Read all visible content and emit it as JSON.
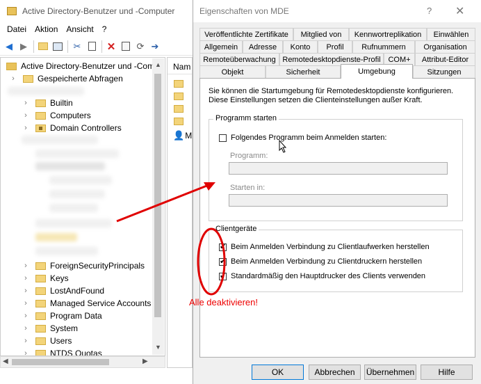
{
  "main_window": {
    "title": "Active Directory-Benutzer und -Computer",
    "menu": [
      "Datei",
      "Aktion",
      "Ansicht",
      "?"
    ],
    "tree_root": "Active Directory-Benutzer und -Com",
    "tree_items_top": [
      "Gespeicherte Abfragen",
      "Builtin",
      "Computers",
      "Domain Controllers"
    ],
    "tree_items_bottom": [
      "ForeignSecurityPrincipals",
      "Keys",
      "LostAndFound",
      "Managed Service Accounts",
      "Program Data",
      "System",
      "Users",
      "NTDS Quotas"
    ],
    "list_column": "Nam",
    "list_user_label": "M"
  },
  "dialog": {
    "title": "Eigenschaften von MDE",
    "help_glyph": "?",
    "close_glyph": "✕",
    "tabs_row1": [
      "Veröffentlichte Zertifikate",
      "Mitglied von",
      "Kennwortreplikation",
      "Einwählen"
    ],
    "tabs_row2": [
      "Allgemein",
      "Adresse",
      "Konto",
      "Profil",
      "Rufnummern",
      "Organisation"
    ],
    "tabs_row3": [
      "Remoteüberwachung",
      "Remotedesktopdienste-Profil",
      "COM+",
      "Attribut-Editor"
    ],
    "tabs_row4": [
      "Objekt",
      "Sicherheit",
      "Umgebung",
      "Sitzungen"
    ],
    "active_tab": "Umgebung",
    "description": "Sie können die Startumgebung für Remotedesktopdienste konfigurieren. Diese Einstellungen setzen die Clienteinstellungen außer Kraft.",
    "group_program": {
      "label": "Programm starten",
      "checkbox": {
        "label": "Folgendes Programm beim Anmelden starten:",
        "checked": false
      },
      "program_label": "Programm:",
      "program_value": "",
      "start_in_label": "Starten in:",
      "start_in_value": ""
    },
    "group_client": {
      "label": "Clientgeräte",
      "checkboxes": [
        {
          "label": "Beim Anmelden Verbindung zu Clientlaufwerken herstellen",
          "checked": true
        },
        {
          "label": "Beim Anmelden Verbindung zu Clientdruckern herstellen",
          "checked": true
        },
        {
          "label": "Standardmäßig den Hauptdrucker des Clients verwenden",
          "checked": true
        }
      ]
    },
    "buttons": {
      "ok": "OK",
      "cancel": "Abbrechen",
      "apply": "Übernehmen",
      "help": "Hilfe"
    }
  },
  "annotation": {
    "text": "Alle deaktivieren!",
    "color": "#e00000"
  }
}
